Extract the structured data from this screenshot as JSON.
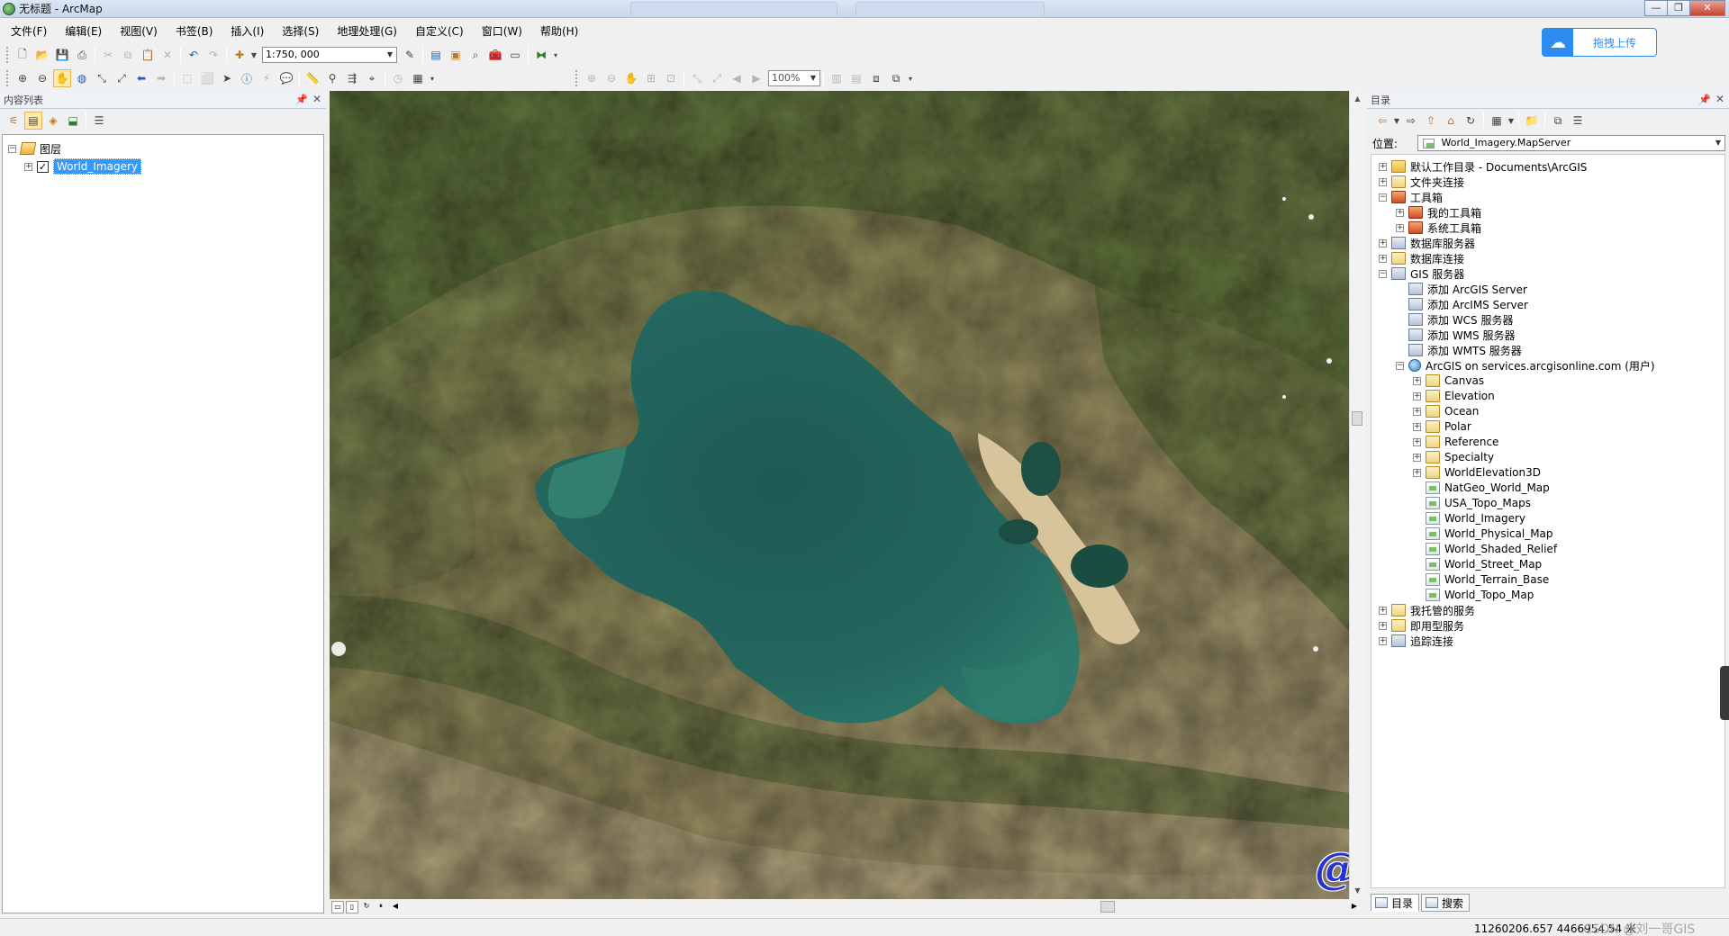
{
  "window": {
    "title": "无标题 - ArcMap"
  },
  "upload_widget": {
    "label": "拖拽上传"
  },
  "menu": [
    "文件(F)",
    "编辑(E)",
    "视图(V)",
    "书签(B)",
    "插入(I)",
    "选择(S)",
    "地理处理(G)",
    "自定义(C)",
    "窗口(W)",
    "帮助(H)"
  ],
  "toolbar": {
    "scale": "1:750, 000",
    "zoom": "100%"
  },
  "toc": {
    "title": "内容列表",
    "root_label": "图层",
    "layers": [
      {
        "name": "World_Imagery",
        "checked": true,
        "check_mark": "✓"
      }
    ]
  },
  "catalog": {
    "title": "目录",
    "location_label": "位置:",
    "location_value": "World_Imagery.MapServer",
    "tree": [
      {
        "label": "默认工作目录 - Documents\\ArcGIS",
        "level": 0,
        "expander": "+",
        "icon": "folder-home"
      },
      {
        "label": "文件夹连接",
        "level": 0,
        "expander": "+",
        "icon": "folder"
      },
      {
        "label": "工具箱",
        "level": 0,
        "expander": "−",
        "icon": "toolbox"
      },
      {
        "label": "我的工具箱",
        "level": 1,
        "expander": "+",
        "icon": "toolbox"
      },
      {
        "label": "系统工具箱",
        "level": 1,
        "expander": "+",
        "icon": "toolbox"
      },
      {
        "label": "数据库服务器",
        "level": 0,
        "expander": "+",
        "icon": "server"
      },
      {
        "label": "数据库连接",
        "level": 0,
        "expander": "+",
        "icon": "folder"
      },
      {
        "label": "GIS 服务器",
        "level": 0,
        "expander": "−",
        "icon": "server"
      },
      {
        "label": "添加 ArcGIS Server",
        "level": 1,
        "expander": "",
        "icon": "server"
      },
      {
        "label": "添加 ArcIMS Server",
        "level": 1,
        "expander": "",
        "icon": "server"
      },
      {
        "label": "添加 WCS 服务器",
        "level": 1,
        "expander": "",
        "icon": "server"
      },
      {
        "label": "添加 WMS 服务器",
        "level": 1,
        "expander": "",
        "icon": "server"
      },
      {
        "label": "添加 WMTS 服务器",
        "level": 1,
        "expander": "",
        "icon": "server"
      },
      {
        "label": "ArcGIS on services.arcgisonline.com (用户)",
        "level": 1,
        "expander": "−",
        "icon": "globe"
      },
      {
        "label": "Canvas",
        "level": 2,
        "expander": "+",
        "icon": "folder"
      },
      {
        "label": "Elevation",
        "level": 2,
        "expander": "+",
        "icon": "folder"
      },
      {
        "label": "Ocean",
        "level": 2,
        "expander": "+",
        "icon": "folder"
      },
      {
        "label": "Polar",
        "level": 2,
        "expander": "+",
        "icon": "folder"
      },
      {
        "label": "Reference",
        "level": 2,
        "expander": "+",
        "icon": "folder"
      },
      {
        "label": "Specialty",
        "level": 2,
        "expander": "+",
        "icon": "folder"
      },
      {
        "label": "WorldElevation3D",
        "level": 2,
        "expander": "+",
        "icon": "folder"
      },
      {
        "label": "NatGeo_World_Map",
        "level": 2,
        "expander": "",
        "icon": "map-service"
      },
      {
        "label": "USA_Topo_Maps",
        "level": 2,
        "expander": "",
        "icon": "map-service"
      },
      {
        "label": "World_Imagery",
        "level": 2,
        "expander": "",
        "icon": "map-service"
      },
      {
        "label": "World_Physical_Map",
        "level": 2,
        "expander": "",
        "icon": "map-service"
      },
      {
        "label": "World_Shaded_Relief",
        "level": 2,
        "expander": "",
        "icon": "map-service"
      },
      {
        "label": "World_Street_Map",
        "level": 2,
        "expander": "",
        "icon": "map-service"
      },
      {
        "label": "World_Terrain_Base",
        "level": 2,
        "expander": "",
        "icon": "map-service"
      },
      {
        "label": "World_Topo_Map",
        "level": 2,
        "expander": "",
        "icon": "map-service"
      },
      {
        "label": "我托管的服务",
        "level": 0,
        "expander": "+",
        "icon": "folder"
      },
      {
        "label": "即用型服务",
        "level": 0,
        "expander": "+",
        "icon": "folder"
      },
      {
        "label": "追踪连接",
        "level": 0,
        "expander": "+",
        "icon": "server"
      }
    ],
    "tabs": [
      "目录",
      "搜索"
    ]
  },
  "map": {
    "watermark": "@ 刘一哥GIS"
  },
  "status": {
    "coordinates": "11260206.657  4466954.54 米",
    "credit": "CSDN @刘一哥GIS"
  }
}
